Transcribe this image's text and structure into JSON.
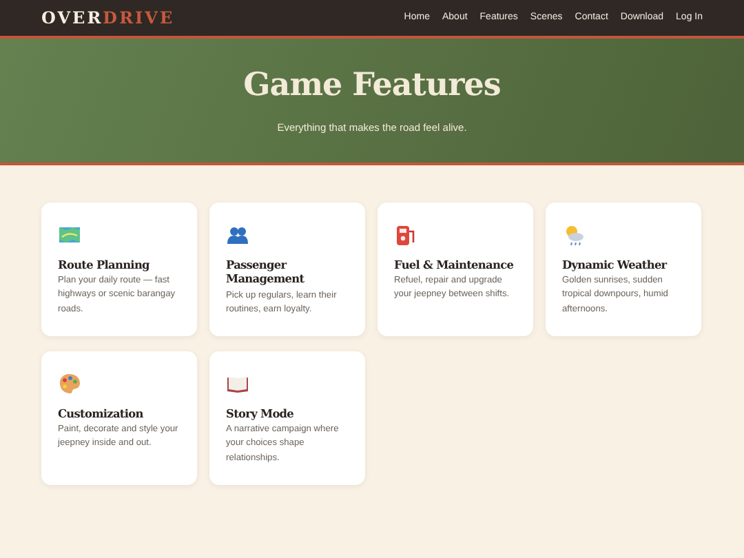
{
  "navbar": {
    "brand": [
      {
        "text": "OVER",
        "accent": false
      },
      {
        "text": "DRIVE",
        "accent": true
      }
    ],
    "links": [
      {
        "label": "Home"
      },
      {
        "label": "About"
      },
      {
        "label": "Features"
      },
      {
        "label": "Scenes"
      },
      {
        "label": "Contact"
      },
      {
        "label": "Download"
      },
      {
        "label": "Log In"
      }
    ]
  },
  "hero": {
    "title": "Game Features",
    "subtitle": "Everything that makes the road feel alive."
  },
  "features": [
    {
      "kind": "map",
      "title": "Route Planning",
      "text": "Plan your daily route — fast highways or scenic barangay roads."
    },
    {
      "kind": "people",
      "title": "Passenger Management",
      "text": "Pick up regulars, learn their routines, earn loyalty."
    },
    {
      "kind": "fuel",
      "title": "Fuel & Maintenance",
      "text": "Refuel, repair and upgrade your jeepney between shifts."
    },
    {
      "kind": "weather",
      "title": "Dynamic Weather",
      "text": "Golden sunrises, sudden tropical downpours, humid afternoons."
    },
    {
      "kind": "palette",
      "title": "Customization",
      "text": "Paint, decorate and style your jeepney inside and out."
    },
    {
      "kind": "book",
      "title": "Story Mode",
      "text": "A narrative campaign where your choices shape relationships."
    }
  ]
}
